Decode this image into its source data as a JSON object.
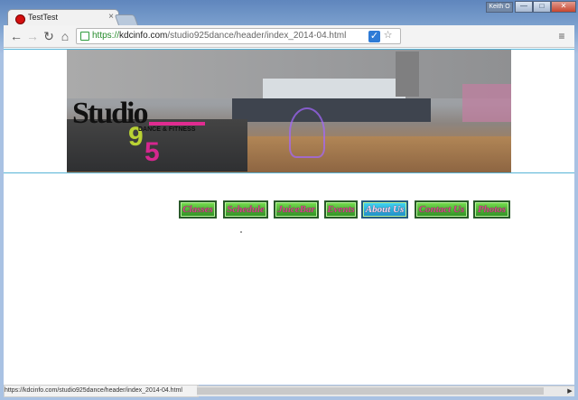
{
  "browser": {
    "tab_title": "TestTest",
    "tab_close": "×",
    "user": "Keith O",
    "window_min": "—",
    "window_max": "□",
    "window_close": "✕"
  },
  "toolbar": {
    "back_icon": "←",
    "forward_icon": "→",
    "reload_icon": "↻",
    "home_icon": "⌂",
    "url_scheme": "https://",
    "url_host": "kdcinfo.com",
    "url_path": "/studio925dance/header/index_2014-04.html",
    "menu_icon": "≡"
  },
  "logo": {
    "studio": "Studio",
    "nine": "9",
    "five": "5",
    "tagline": "DANCE & FITNESS"
  },
  "menu": {
    "items": [
      "Classes",
      "Schedule",
      "JuiceBar",
      "Events",
      "About Us",
      "Contact Us",
      "Photos"
    ],
    "active_index": 4
  },
  "status": {
    "url": "https://kdcinfo.com/studio925dance/header/index_2014-04.html"
  },
  "colors": {
    "accent_line": "#57b4d7",
    "menu_green": "#2e8f23",
    "menu_pink": "#d7428c",
    "active_blue": "#1e8bc6",
    "logo_green": "#b9d234",
    "logo_pink": "#d5278f"
  }
}
